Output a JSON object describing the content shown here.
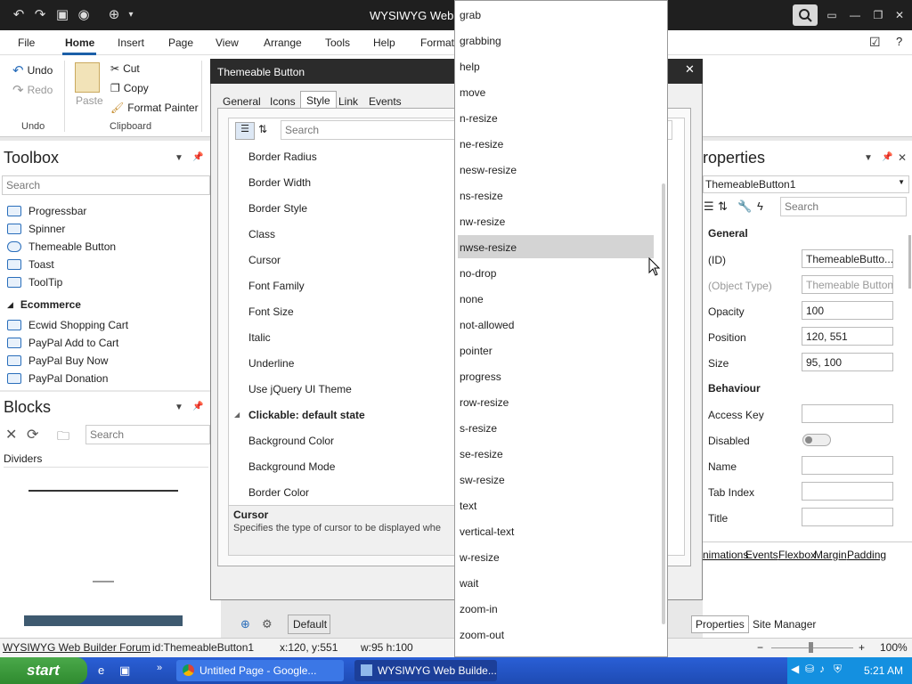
{
  "window": {
    "title": "WYSIWYG Web Bu",
    "search_icon": "search-icon"
  },
  "menu": [
    "File",
    "Home",
    "Insert",
    "Page",
    "View",
    "Arrange",
    "Tools",
    "Help",
    "Format"
  ],
  "ribbon": {
    "undo": "Undo",
    "redo": "Redo",
    "paste": "Paste",
    "cut": "Cut",
    "copy": "Copy",
    "format_painter": "Format Painter",
    "group_undo": "Undo",
    "group_clipboard": "Clipboard"
  },
  "toolbox": {
    "title": "Toolbox",
    "search_placeholder": "Search",
    "items": [
      "Progressbar",
      "Spinner",
      "Themeable Button",
      "Toast",
      "ToolTip"
    ],
    "category": "Ecommerce",
    "ecommerce_items": [
      "Ecwid Shopping Cart",
      "PayPal Add to Cart",
      "PayPal Buy Now",
      "PayPal Donation"
    ]
  },
  "blocks": {
    "title": "Blocks",
    "search_placeholder": "Search",
    "section": "Dividers"
  },
  "dialog": {
    "title": "Themeable Button",
    "tabs": [
      "General",
      "Icons",
      "Style",
      "Link",
      "Events"
    ],
    "search_placeholder": "Search",
    "properties": [
      "Border Radius",
      "Border Width",
      "Border Style",
      "Class",
      "Cursor",
      "Font Family",
      "Font Size",
      "Italic",
      "Underline",
      "Use jQuery UI Theme"
    ],
    "category": "Clickable: default state",
    "category_props": [
      "Background Color",
      "Background Mode",
      "Border Color"
    ],
    "desc_title": "Cursor",
    "desc_text": "Specifies the type of cursor to be displayed whe",
    "bottom_label": "Default"
  },
  "dropdown": {
    "items": [
      "grab",
      "grabbing",
      "help",
      "move",
      "n-resize",
      "ne-resize",
      "nesw-resize",
      "ns-resize",
      "nw-resize",
      "nwse-resize",
      "no-drop",
      "none",
      "not-allowed",
      "pointer",
      "progress",
      "row-resize",
      "s-resize",
      "se-resize",
      "sw-resize",
      "text",
      "vertical-text",
      "w-resize",
      "wait",
      "zoom-in",
      "zoom-out"
    ],
    "selected": "nwse-resize"
  },
  "properties": {
    "title": "roperties",
    "object": "ThemeableButton1",
    "search_placeholder": "Search",
    "general_label": "General",
    "rows": [
      {
        "label": "(ID)",
        "value": "ThemeableButto..."
      },
      {
        "label": "(Object Type)",
        "value": "Themeable Button"
      },
      {
        "label": "Opacity",
        "value": "100"
      },
      {
        "label": "Position",
        "value": "120, 551"
      },
      {
        "label": "Size",
        "value": "95, 100"
      }
    ],
    "behaviour_label": "Behaviour",
    "behaviour_rows": [
      "Access Key",
      "Disabled",
      "Name",
      "Tab Index",
      "Title"
    ],
    "links": [
      "nimations",
      "Events",
      "Flexbox",
      "Margin",
      "Padding"
    ],
    "tabs": [
      "Properties",
      "Site Manager"
    ]
  },
  "status": {
    "forum": "WYSIWYG Web Builder Forum",
    "id": "id:ThemeableButton1",
    "pos": "x:120, y:551",
    "size": "w:95 h:100",
    "zoom": "100%"
  },
  "taskbar": {
    "start": "start",
    "tasks": [
      "Untitled Page - Google...",
      "WYSIWYG Web Builde..."
    ],
    "clock": "5:21 AM"
  }
}
